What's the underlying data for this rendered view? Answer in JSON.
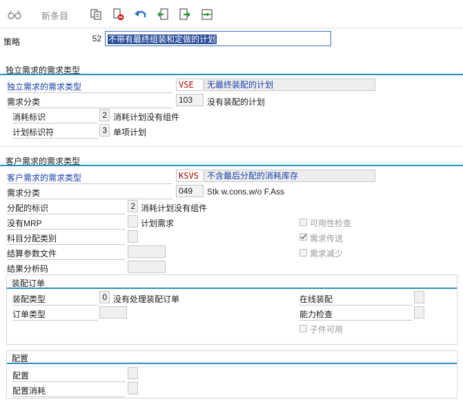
{
  "toolbar": {
    "new_entries_label": "新条目"
  },
  "strategy": {
    "label": "策略",
    "code": "52",
    "description": "不带有最终组装和定做的计划"
  },
  "independent_section": {
    "title": "独立需求的需求类型",
    "type_label": "独立需求的需求类型",
    "type_code": "VSE",
    "type_desc": "无最终装配的计划",
    "class_label": "需求分类",
    "class_code": "103",
    "class_desc": "没有装配的计划",
    "consumption_label": "消耗标识",
    "consumption_code": "2",
    "consumption_desc": "消耗计划没有组件",
    "planning_label": "计划标识符",
    "planning_code": "3",
    "planning_desc": "单项计划"
  },
  "customer_section": {
    "title": "客户需求的需求类型",
    "type_label": "客户需求的需求类型",
    "type_code": "KSVS",
    "type_desc": "不含最后分配的消耗库存",
    "class_label": "需求分类",
    "class_code": "049",
    "class_desc": "Stk w.cons.w/o F.Ass",
    "alloc_label": "分配的标识",
    "alloc_code": "2",
    "alloc_desc": "消耗计划没有组件",
    "no_mrp_label": "没有MRP",
    "no_mrp_desc": "计划需求",
    "acct_label": "科目分配类别",
    "settle_label": "结算参数文件",
    "result_label": "结果分析码",
    "availability_check": "可用性检查",
    "req_transfer": "需求传送",
    "req_reduce": "需求减少"
  },
  "assembly_order": {
    "title": "装配订单",
    "type_label": "装配类型",
    "type_code": "0",
    "type_desc": "没有处理装配订单",
    "order_type_label": "订单类型",
    "online_assembly": "在线装配",
    "capacity_check": "能力检查",
    "component_avail": "子件可用"
  },
  "configuration": {
    "title": "配置",
    "config_label": "配置",
    "config_consumption_label": "配置消耗"
  }
}
